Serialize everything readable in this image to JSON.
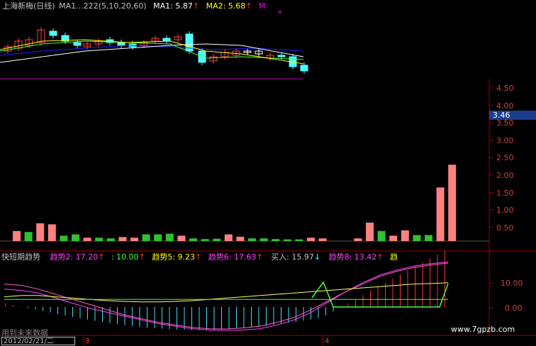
{
  "top_panel": {
    "title": "上海新梅(日线)",
    "ma_params": "MA1...222(5,10,20,60)",
    "ma1_label": "MA1: 5.87",
    "ma1_arrow": "↑",
    "ma2_label": "MA2: 5.68",
    "ma2_arrow": "↑",
    "ma_more": "M",
    "marker": "×"
  },
  "axis": {
    "ticks": [
      "4.50",
      "4.00",
      "3.50",
      "3.00",
      "2.50",
      "2.00",
      "1.50",
      "1.00",
      "0.50"
    ],
    "current_value": "3.46",
    "low_ticks": [
      "10.00",
      "0.00"
    ]
  },
  "indicator": {
    "name": "快短期趋势",
    "trend2": "趋势2: 17.20",
    "trend2_arrow": "↑",
    "trend3": ": 10.00",
    "trend3_arrow": "↑",
    "trend5": "趋势5: 9.23",
    "trend5_arrow": "↑",
    "trend6": "趋势6: 17.63",
    "trend6_arrow": "↑",
    "buy": "买入: 15.97",
    "buy_arrow": "↓",
    "trend8": "趋势8: 13.42",
    "trend8_arrow": "↑",
    "trend_cut": "趋"
  },
  "bottom": {
    "future_data": "用到未来数据",
    "date": "2012/02/21/二",
    "marker_left": "3",
    "marker_right": "4",
    "watermark": "www.7gpzb.com"
  },
  "chart_data": [
    {
      "type": "bar",
      "name": "volume",
      "values": [
        0.3,
        0.27,
        0.53,
        0.5,
        0.16,
        0.2,
        0.1,
        0.1,
        0.08,
        0.12,
        0.1,
        0.2,
        0.2,
        0.22,
        0.16,
        0.08,
        0.06,
        0.07,
        0.2,
        0.13,
        0.08,
        0.08,
        0.06,
        0.05,
        0.05,
        0.1,
        0.08,
        0.0,
        0.0,
        0.08,
        0.55,
        0.3,
        0.16,
        0.32,
        0.18,
        0.18,
        1.6,
        2.28
      ],
      "colors": [
        "red",
        "green",
        "red",
        "red",
        "green",
        "green",
        "red",
        "green",
        "green",
        "red",
        "red",
        "green",
        "green",
        "green",
        "red",
        "green",
        "green",
        "green",
        "red",
        "red",
        "green",
        "green",
        "green",
        "green",
        "green",
        "red",
        "red",
        "red",
        "red",
        "red",
        "red",
        "green",
        "red",
        "red",
        "green",
        "green",
        "red",
        "red"
      ],
      "ylim": [
        0,
        4.7
      ]
    },
    {
      "type": "line",
      "name": "trend-indicator",
      "series": [
        {
          "values": [
            7,
            6.5,
            5.5,
            3.5,
            1.5,
            -0.5,
            -2,
            -3.5,
            -5,
            -6.5,
            -7.5,
            -8.5,
            -9,
            -9.2,
            -9,
            -8.5,
            -7,
            -5,
            -2,
            2,
            6,
            9.5,
            12.5,
            14.5,
            16,
            17,
            17.6
          ]
        },
        {
          "values": [
            9,
            8.5,
            7,
            5,
            3,
            1,
            -1,
            -3,
            -4.5,
            -6,
            -7,
            -8,
            -8.5,
            -8.6,
            -8.2,
            -7.5,
            -6,
            -4,
            -1,
            2.5,
            6,
            9,
            12,
            14,
            15.5,
            16.5,
            17.2
          ]
        },
        {
          "values": [
            4,
            4.5,
            4.5,
            4,
            3.5,
            3,
            2.5,
            2.2,
            2,
            2,
            2.2,
            2.5,
            3,
            3.5,
            4,
            4.5,
            5,
            5.5,
            6,
            6.5,
            7,
            7.5,
            8,
            8.5,
            9,
            9.2,
            9.5
          ]
        },
        {
          "values": [
            3,
            3,
            3,
            3,
            3,
            3,
            3,
            3,
            3,
            3,
            3,
            3,
            3,
            3,
            3,
            3,
            3,
            3,
            3,
            3,
            3,
            3,
            3,
            3,
            3,
            3,
            3
          ]
        }
      ],
      "ylim": [
        -20,
        20
      ]
    }
  ]
}
